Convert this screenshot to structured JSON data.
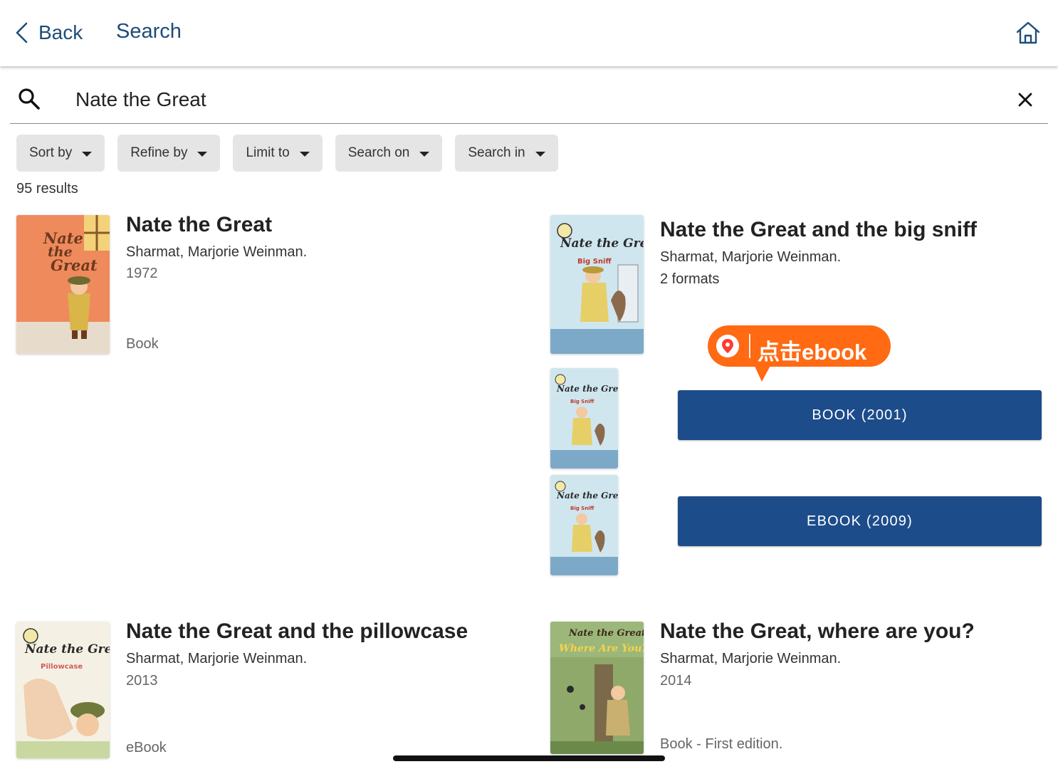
{
  "header": {
    "back_label": "Back",
    "title": "Search"
  },
  "search": {
    "value": "Nate the Great"
  },
  "filters": [
    "Sort by",
    "Refine by",
    "Limit to",
    "Search on",
    "Search in"
  ],
  "results_count": "95 results",
  "results": [
    {
      "title": "Nate the Great",
      "author": "Sharmat, Marjorie Weinman.",
      "meta": "1972",
      "format": "Book",
      "cover_title": [
        "Nate",
        "the",
        "Great"
      ]
    },
    {
      "title": "Nate the Great and the big sniff",
      "author": "Sharmat, Marjorie Weinman.",
      "meta": "2 formats",
      "cover_title": "Nate the Great",
      "cover_sub": "Big Sniff",
      "formats": [
        "BOOK (2001)",
        "EBOOK (2009)"
      ]
    },
    {
      "title": "Nate the Great and the pillowcase",
      "author": "Sharmat, Marjorie Weinman.",
      "meta": "2013",
      "format": "eBook",
      "cover_title": "Nate the Great",
      "cover_sub": "Pillowcase"
    },
    {
      "title": "Nate the Great, where are you?",
      "author": "Sharmat, Marjorie Weinman.",
      "meta": "2014",
      "format": "Book - First edition.",
      "cover_title": "Nate the Great",
      "cover_sub": "Where Are You?"
    }
  ],
  "tooltip": {
    "text": "点击ebook"
  },
  "colors": {
    "header_text": "#1d4d7a",
    "format_button": "#1d4c8a",
    "tooltip": "#ff6a13",
    "chip_bg": "#e5e5e5"
  }
}
